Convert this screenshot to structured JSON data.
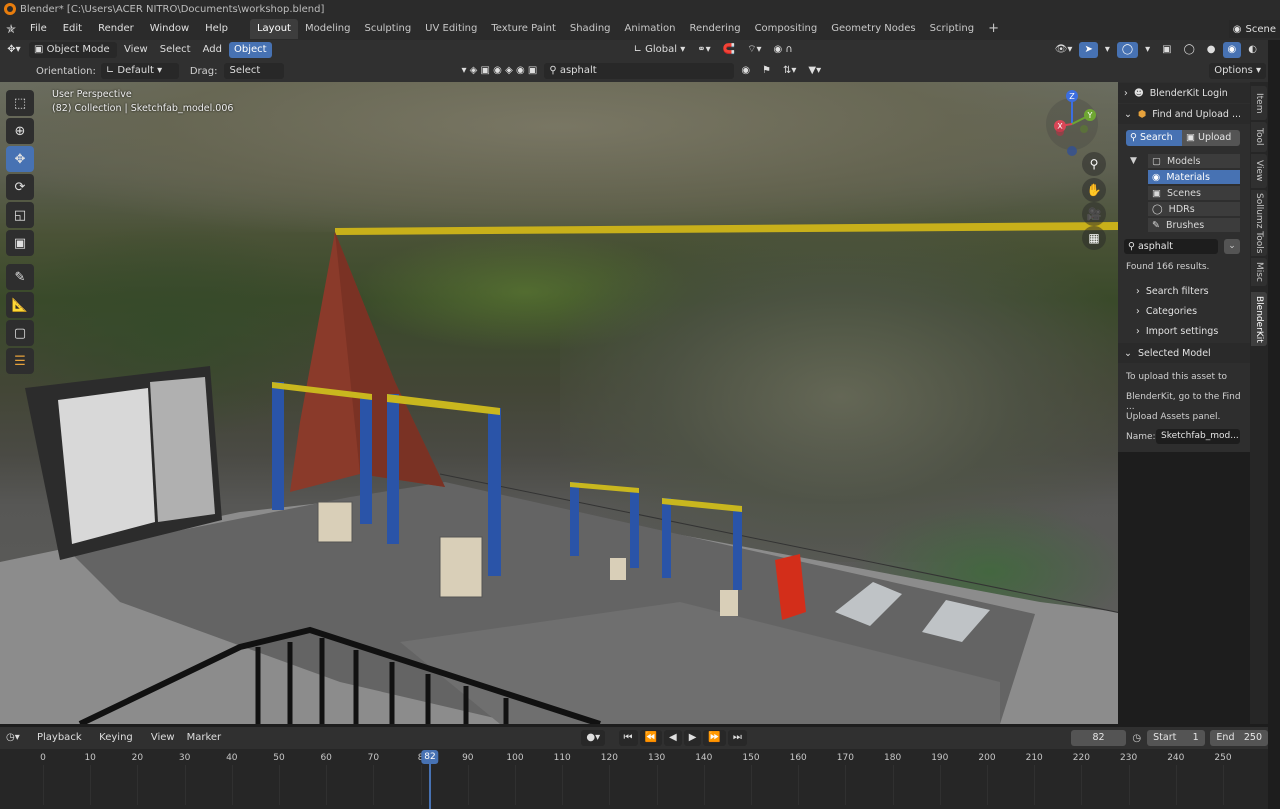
{
  "title_bar": {
    "text": "Blender* [C:\\Users\\ACER NITRO\\Documents\\workshop.blend]"
  },
  "menu": [
    "File",
    "Edit",
    "Render",
    "Window",
    "Help"
  ],
  "workspaces": [
    "Layout",
    "Modeling",
    "Sculpting",
    "UV Editing",
    "Texture Paint",
    "Shading",
    "Animation",
    "Rendering",
    "Compositing",
    "Geometry Nodes",
    "Scripting"
  ],
  "active_workspace": "Layout",
  "scene": "Scene",
  "header": {
    "mode": "Object Mode",
    "view": "View",
    "select": "Select",
    "add": "Add",
    "object": "Object",
    "transform": "Global"
  },
  "tool_settings": {
    "orientation_label": "Orientation:",
    "orientation_value": "Default",
    "drag_label": "Drag:",
    "drag_value": "Select Box",
    "search_value": "asphalt",
    "options": "Options"
  },
  "viewport": {
    "line1": "User Perspective",
    "line2": "(82) Collection | Sketchfab_model.006",
    "gizmo": {
      "z": "Z",
      "y": "Y",
      "x": "X"
    }
  },
  "npanel": {
    "login": "BlenderKit Login",
    "find_upload": "Find and Upload ...",
    "search_btn": "Search",
    "upload_btn": "Upload",
    "asset_types": [
      "Models",
      "Materials",
      "Scenes",
      "HDRs",
      "Brushes"
    ],
    "active_asset_type": "Materials",
    "search_value": "asphalt",
    "results": "Found 166 results.",
    "search_filters": "Search filters",
    "categories": "Categories",
    "import_settings": "Import settings",
    "selected_model": "Selected Model",
    "info1": "To upload this asset to",
    "info2": "BlenderKit, go to the Find ...",
    "info3": "Upload Assets panel.",
    "name_label": "Name:",
    "name_value": "Sketchfab_mod..."
  },
  "side_tabs": [
    "Item",
    "Tool",
    "View",
    "Sollumz Tools",
    "Misc",
    "BlenderKit"
  ],
  "active_side_tab": "BlenderKit",
  "timeline": {
    "playback": "Playback",
    "keying": "Keying",
    "view": "View",
    "marker": "Marker",
    "current_frame": "82",
    "start_label": "Start",
    "start": "1",
    "end_label": "End",
    "end": "250",
    "ticks": [
      "0",
      "10",
      "20",
      "30",
      "40",
      "50",
      "60",
      "70",
      "8",
      "90",
      "100",
      "110",
      "120",
      "130",
      "140",
      "150",
      "160",
      "170",
      "180",
      "190",
      "200",
      "210",
      "220",
      "230",
      "240",
      "250"
    ]
  },
  "colors": {
    "accent": "#4772b3",
    "header": "#303030",
    "window": "#2b2b2b"
  }
}
